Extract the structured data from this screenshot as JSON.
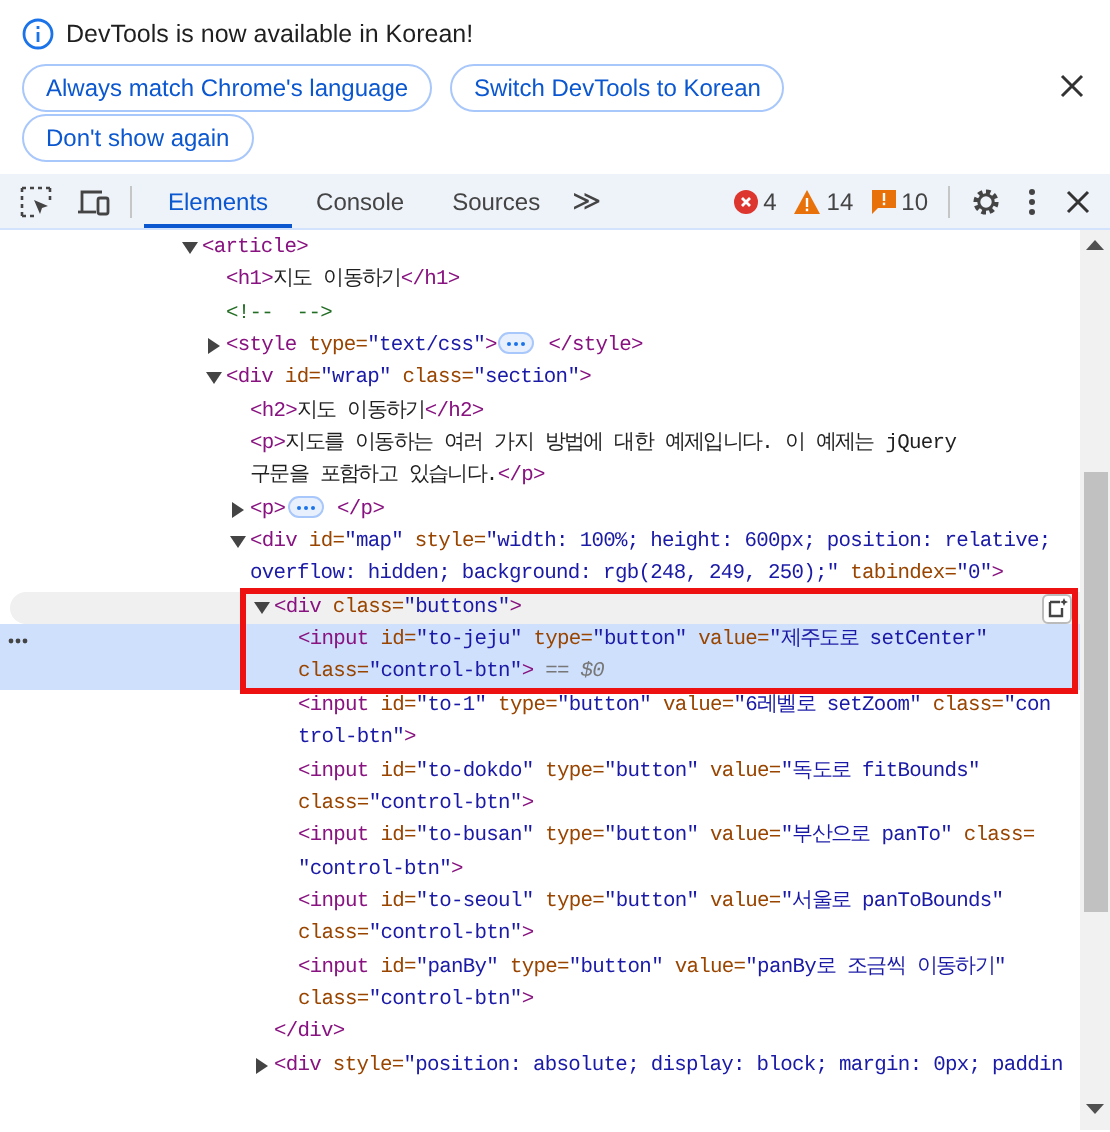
{
  "infobar": {
    "message": "DevTools is now available in Korean!",
    "buttons": [
      "Always match Chrome's language",
      "Switch DevTools to Korean",
      "Don't show again"
    ]
  },
  "toolbar": {
    "tabs": [
      {
        "label": "Elements",
        "selected": true
      },
      {
        "label": "Console",
        "selected": false
      },
      {
        "label": "Sources",
        "selected": false
      }
    ],
    "more_tabs": "≫",
    "errors": "4",
    "warnings": "14",
    "issues": "10"
  },
  "tree": [
    {
      "expanded": true,
      "lines": [
        [
          {
            "kind": "tag",
            "text": "<article>"
          }
        ]
      ],
      "children": [
        {
          "lines": [
            [
              {
                "kind": "tag",
                "text": "<h1>"
              },
              {
                "kind": "text",
                "text": "지도 이동하기"
              },
              {
                "kind": "tag",
                "text": "</h1>"
              }
            ]
          ]
        },
        {
          "lines": [
            [
              {
                "kind": "comment",
                "text": "<!--  -->"
              }
            ]
          ]
        },
        {
          "expanded": false,
          "lines": [
            [
              {
                "kind": "tag",
                "text": "<style"
              },
              {
                "kind": "attr",
                "text": " type="
              },
              {
                "kind": "val",
                "text": "\"text/css\""
              },
              {
                "kind": "tag",
                "text": ">"
              },
              {
                "kind": "more"
              },
              {
                "kind": "tag",
                "text": " </style>"
              }
            ]
          ]
        },
        {
          "expanded": true,
          "lines": [
            [
              {
                "kind": "tag",
                "text": "<div"
              },
              {
                "kind": "attr",
                "text": " id="
              },
              {
                "kind": "val",
                "text": "\"wrap\""
              },
              {
                "kind": "attr",
                "text": " class="
              },
              {
                "kind": "val",
                "text": "\"section\""
              },
              {
                "kind": "tag",
                "text": ">"
              }
            ]
          ],
          "children": [
            {
              "lines": [
                [
                  {
                    "kind": "tag",
                    "text": "<h2>"
                  },
                  {
                    "kind": "text",
                    "text": "지도 이동하기"
                  },
                  {
                    "kind": "tag",
                    "text": "</h2>"
                  }
                ]
              ]
            },
            {
              "lines": [
                [
                  {
                    "kind": "tag",
                    "text": "<p>"
                  },
                  {
                    "kind": "text",
                    "text": "지도를 이동하는 여러 가지 방법에 대한 예제입니다. 이 예제는 jQuery"
                  }
                ],
                [
                  {
                    "kind": "text",
                    "text": "구문을 포함하고 있습니다."
                  },
                  {
                    "kind": "tag",
                    "text": "</p>"
                  }
                ]
              ]
            },
            {
              "expanded": false,
              "lines": [
                [
                  {
                    "kind": "tag",
                    "text": "<p>"
                  },
                  {
                    "kind": "more"
                  },
                  {
                    "kind": "tag",
                    "text": " </p>"
                  }
                ]
              ]
            },
            {
              "expanded": true,
              "lines": [
                [
                  {
                    "kind": "tag",
                    "text": "<div"
                  },
                  {
                    "kind": "attr",
                    "text": " id="
                  },
                  {
                    "kind": "val",
                    "text": "\"map\""
                  },
                  {
                    "kind": "attr",
                    "text": " style="
                  },
                  {
                    "kind": "val",
                    "text": "\"width: 100%; height: 600px; position: relative;"
                  }
                ],
                [
                  {
                    "kind": "val",
                    "text": "overflow: hidden; background: rgb(248, 249, 250);\""
                  },
                  {
                    "kind": "attr",
                    "text": " tabindex="
                  },
                  {
                    "kind": "val",
                    "text": "\"0\""
                  },
                  {
                    "kind": "tag",
                    "text": ">"
                  }
                ]
              ],
              "children": [
                {
                  "expanded": true,
                  "hovered": true,
                  "annotated": true,
                  "lines": [
                    [
                      {
                        "kind": "tag",
                        "text": "<div"
                      },
                      {
                        "kind": "attr",
                        "text": " class="
                      },
                      {
                        "kind": "val",
                        "text": "\"buttons\""
                      },
                      {
                        "kind": "tag",
                        "text": ">"
                      }
                    ]
                  ],
                  "close": [
                    {
                      "kind": "tag",
                      "text": "</div>"
                    }
                  ],
                  "children": [
                    {
                      "selected": true,
                      "lines": [
                        [
                          {
                            "kind": "tag",
                            "text": "<input"
                          },
                          {
                            "kind": "attr",
                            "text": " id="
                          },
                          {
                            "kind": "val",
                            "text": "\"to-jeju\""
                          },
                          {
                            "kind": "attr",
                            "text": " type="
                          },
                          {
                            "kind": "val",
                            "text": "\"button\""
                          },
                          {
                            "kind": "attr",
                            "text": " value="
                          },
                          {
                            "kind": "val",
                            "text": "\"제주도로 setCenter\""
                          }
                        ],
                        [
                          {
                            "kind": "attr",
                            "text": "class="
                          },
                          {
                            "kind": "val",
                            "text": "\"control-btn\""
                          },
                          {
                            "kind": "tag",
                            "text": ">"
                          },
                          {
                            "kind": "dim",
                            "text": " == $0"
                          }
                        ]
                      ]
                    },
                    {
                      "selected": false,
                      "lines": [
                        [
                          {
                            "kind": "tag",
                            "text": "<input"
                          },
                          {
                            "kind": "attr",
                            "text": " id="
                          },
                          {
                            "kind": "val",
                            "text": "\"to-1\""
                          },
                          {
                            "kind": "attr",
                            "text": " type="
                          },
                          {
                            "kind": "val",
                            "text": "\"button\""
                          },
                          {
                            "kind": "attr",
                            "text": " value="
                          },
                          {
                            "kind": "val",
                            "text": "\"6레벨로 setZoom\""
                          },
                          {
                            "kind": "attr",
                            "text": " class="
                          },
                          {
                            "kind": "val",
                            "text": "\"con"
                          }
                        ],
                        [
                          {
                            "kind": "val",
                            "text": "trol-btn\""
                          },
                          {
                            "kind": "tag",
                            "text": ">"
                          }
                        ]
                      ]
                    },
                    {
                      "selected": false,
                      "lines": [
                        [
                          {
                            "kind": "tag",
                            "text": "<input"
                          },
                          {
                            "kind": "attr",
                            "text": " id="
                          },
                          {
                            "kind": "val",
                            "text": "\"to-dokdo\""
                          },
                          {
                            "kind": "attr",
                            "text": " type="
                          },
                          {
                            "kind": "val",
                            "text": "\"button\""
                          },
                          {
                            "kind": "attr",
                            "text": " value="
                          },
                          {
                            "kind": "val",
                            "text": "\"독도로 fitBounds\""
                          }
                        ],
                        [
                          {
                            "kind": "attr",
                            "text": "class="
                          },
                          {
                            "kind": "val",
                            "text": "\"control-btn\""
                          },
                          {
                            "kind": "tag",
                            "text": ">"
                          }
                        ]
                      ]
                    },
                    {
                      "selected": false,
                      "lines": [
                        [
                          {
                            "kind": "tag",
                            "text": "<input"
                          },
                          {
                            "kind": "attr",
                            "text": " id="
                          },
                          {
                            "kind": "val",
                            "text": "\"to-busan\""
                          },
                          {
                            "kind": "attr",
                            "text": " type="
                          },
                          {
                            "kind": "val",
                            "text": "\"button\""
                          },
                          {
                            "kind": "attr",
                            "text": " value="
                          },
                          {
                            "kind": "val",
                            "text": "\"부산으로 panTo\""
                          },
                          {
                            "kind": "attr",
                            "text": " class="
                          }
                        ],
                        [
                          {
                            "kind": "val",
                            "text": "\"control-btn\""
                          },
                          {
                            "kind": "tag",
                            "text": ">"
                          }
                        ]
                      ]
                    },
                    {
                      "selected": false,
                      "lines": [
                        [
                          {
                            "kind": "tag",
                            "text": "<input"
                          },
                          {
                            "kind": "attr",
                            "text": " id="
                          },
                          {
                            "kind": "val",
                            "text": "\"to-seoul\""
                          },
                          {
                            "kind": "attr",
                            "text": " type="
                          },
                          {
                            "kind": "val",
                            "text": "\"button\""
                          },
                          {
                            "kind": "attr",
                            "text": " value="
                          },
                          {
                            "kind": "val",
                            "text": "\"서울로 panToBounds\""
                          }
                        ],
                        [
                          {
                            "kind": "attr",
                            "text": "class="
                          },
                          {
                            "kind": "val",
                            "text": "\"control-btn\""
                          },
                          {
                            "kind": "tag",
                            "text": ">"
                          }
                        ]
                      ]
                    },
                    {
                      "selected": false,
                      "lines": [
                        [
                          {
                            "kind": "tag",
                            "text": "<input"
                          },
                          {
                            "kind": "attr",
                            "text": " id="
                          },
                          {
                            "kind": "val",
                            "text": "\"panBy\""
                          },
                          {
                            "kind": "attr",
                            "text": " type="
                          },
                          {
                            "kind": "val",
                            "text": "\"button\""
                          },
                          {
                            "kind": "attr",
                            "text": " value="
                          },
                          {
                            "kind": "val",
                            "text": "\"panBy로 조금씩 이동하기\""
                          }
                        ],
                        [
                          {
                            "kind": "attr",
                            "text": "class="
                          },
                          {
                            "kind": "val",
                            "text": "\"control-btn\""
                          },
                          {
                            "kind": "tag",
                            "text": ">"
                          }
                        ]
                      ]
                    }
                  ]
                },
                {
                  "expanded": false,
                  "lines": [
                    [
                      {
                        "kind": "tag",
                        "text": "<div"
                      },
                      {
                        "kind": "attr",
                        "text": " style="
                      },
                      {
                        "kind": "val",
                        "text": "\"position: absolute; display: block; margin: 0px; paddin"
                      }
                    ]
                  ]
                }
              ]
            }
          ]
        }
      ]
    }
  ]
}
